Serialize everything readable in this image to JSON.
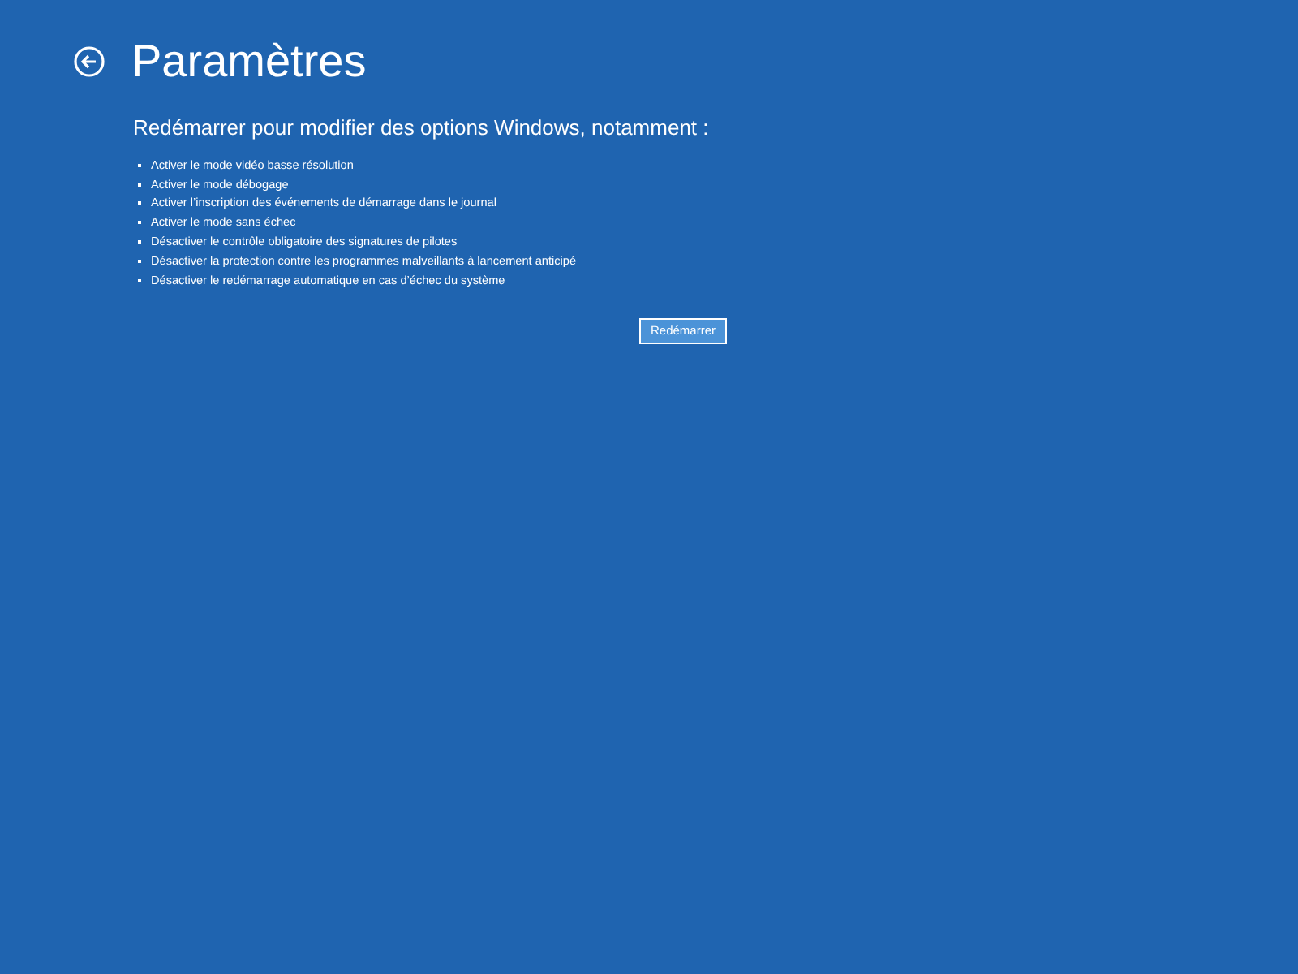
{
  "header": {
    "title": "Paramètres"
  },
  "intro": "Redémarrer pour modifier des options Windows, notamment :",
  "options": [
    "Activer le mode vidéo basse résolution",
    "Activer le mode débogage",
    "Activer l’inscription des événements de démarrage dans le journal",
    "Activer le mode sans échec",
    "Désactiver le contrôle obligatoire des signatures de pilotes",
    "Désactiver la protection contre les programmes malveillants à lancement anticipé",
    "Désactiver le redémarrage automatique en cas d’échec du système"
  ],
  "button": "Redémarrer"
}
